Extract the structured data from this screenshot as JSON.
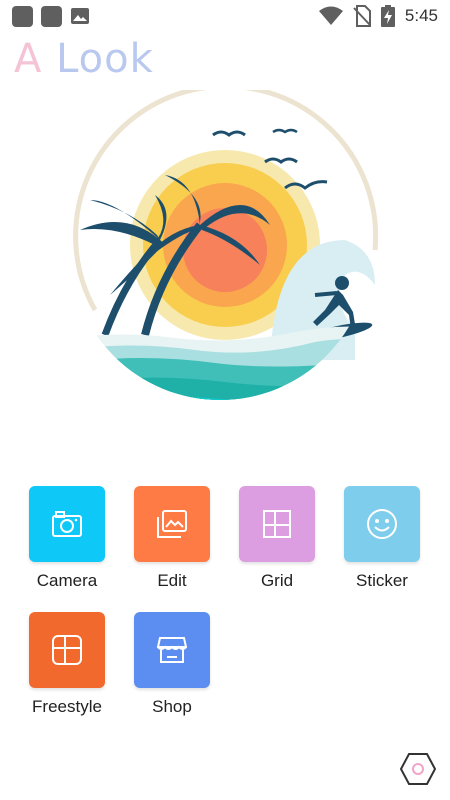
{
  "status_bar": {
    "time": "5:45",
    "icons": [
      "app-notification-icon",
      "app-notification-icon",
      "image-icon",
      "wifi-icon",
      "no-sim-icon",
      "battery-charging-icon"
    ]
  },
  "app": {
    "logo_text_a": "A",
    "logo_text_b": "Look"
  },
  "colors": {
    "camera": "#0ec9f7",
    "edit": "#ff7b45",
    "grid": "#dc9ee0",
    "sticker": "#7fcdec",
    "freestyle": "#f2692d",
    "shop": "#5b8ef0"
  },
  "tiles": [
    {
      "label": "Camera",
      "icon": "camera-icon"
    },
    {
      "label": "Edit",
      "icon": "gallery-edit-icon"
    },
    {
      "label": "Grid",
      "icon": "grid-icon"
    },
    {
      "label": "Sticker",
      "icon": "smiley-icon"
    },
    {
      "label": "Freestyle",
      "icon": "freestyle-layout-icon"
    },
    {
      "label": "Shop",
      "icon": "shop-icon"
    }
  ],
  "settings": {
    "icon": "hexagon-settings-icon"
  }
}
